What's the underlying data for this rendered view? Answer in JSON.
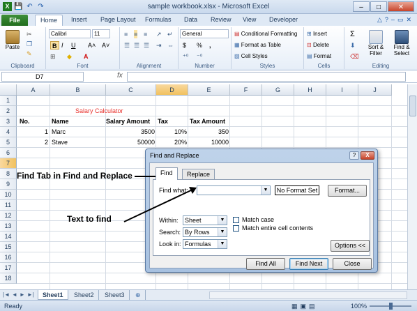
{
  "window": {
    "title": "sample workbook.xlsx - Microsoft Excel",
    "controls": {
      "minimize": "–",
      "maximize": "□",
      "close": "✕"
    }
  },
  "qat": {
    "save": "💾",
    "undo": "↶",
    "redo": "↷"
  },
  "tabs": [
    "File",
    "Home",
    "Insert",
    "Page Layout",
    "Formulas",
    "Data",
    "Review",
    "View",
    "Developer"
  ],
  "active_tab": "Home",
  "ribbon": {
    "clipboard": {
      "label": "Clipboard",
      "paste": "Paste"
    },
    "font": {
      "label": "Font",
      "name": "Calibri",
      "size": "11",
      "bold": "B",
      "italic": "I",
      "underline": "U",
      "grow": "A˄",
      "shrink": "A˅"
    },
    "alignment": {
      "label": "Alignment"
    },
    "number": {
      "label": "Number",
      "format": "General",
      "currency": "$",
      "percent": "%",
      "comma": ","
    },
    "styles": {
      "label": "Styles",
      "cond": "Conditional Formatting",
      "table": "Format as Table",
      "cell": "Cell Styles"
    },
    "cells": {
      "label": "Cells",
      "insert": "Insert",
      "delete": "Delete",
      "format": "Format"
    },
    "editing": {
      "label": "Editing",
      "sum": "Σ",
      "sort": "Sort & Filter",
      "find": "Find & Select"
    }
  },
  "formula_bar": {
    "name_box": "D7",
    "fx": "fx",
    "value": ""
  },
  "columns": [
    "A",
    "B",
    "C",
    "D",
    "E",
    "F",
    "G",
    "H",
    "I",
    "J"
  ],
  "rows": [
    "1",
    "2",
    "3",
    "4",
    "5",
    "6",
    "7",
    "8",
    "9",
    "10",
    "11",
    "12",
    "13",
    "14",
    "15",
    "16",
    "17",
    "18"
  ],
  "selected_col": "D",
  "selected_row": "7",
  "cells": {
    "b3": "Salary Calculator",
    "a4": "No.",
    "b4": "Name",
    "c4": "Salary Amount",
    "d4": "Tax",
    "e4": "Tax Amount",
    "a5": "1",
    "b5": "Marc",
    "c5": "3500",
    "d5": "10%",
    "e5": "350",
    "a6": "2",
    "b6": "Stave",
    "c6": "50000",
    "d6": "20%",
    "e6": "10000"
  },
  "sheets": [
    "Sheet1",
    "Sheet2",
    "Sheet3"
  ],
  "active_sheet": "Sheet1",
  "status": {
    "ready": "Ready",
    "zoom": "100%"
  },
  "dialog": {
    "title": "Find and Replace",
    "help": "?",
    "close": "X",
    "tabs": {
      "find": "Find",
      "replace": "Replace"
    },
    "find_what_label": "Find what:",
    "find_what_value": "",
    "no_format": "No Format Set",
    "format_btn": "Format...",
    "within_label": "Within:",
    "within_value": "Sheet",
    "search_label": "Search:",
    "search_value": "By Rows",
    "look_in_label": "Look in:",
    "look_in_value": "Formulas",
    "match_case": "Match case",
    "match_entire": "Match entire cell contents",
    "options_btn": "Options <<",
    "find_all": "Find All",
    "find_next": "Find Next",
    "close_btn": "Close"
  },
  "annotations": {
    "find_tab": "Find Tab in Find and Replace",
    "text_to_find": "Text to find"
  },
  "colors": {
    "accent": "#1e395b",
    "file_tab": "#2a7a25",
    "selection": "#f1c15f",
    "title_red": "#e8322d"
  }
}
